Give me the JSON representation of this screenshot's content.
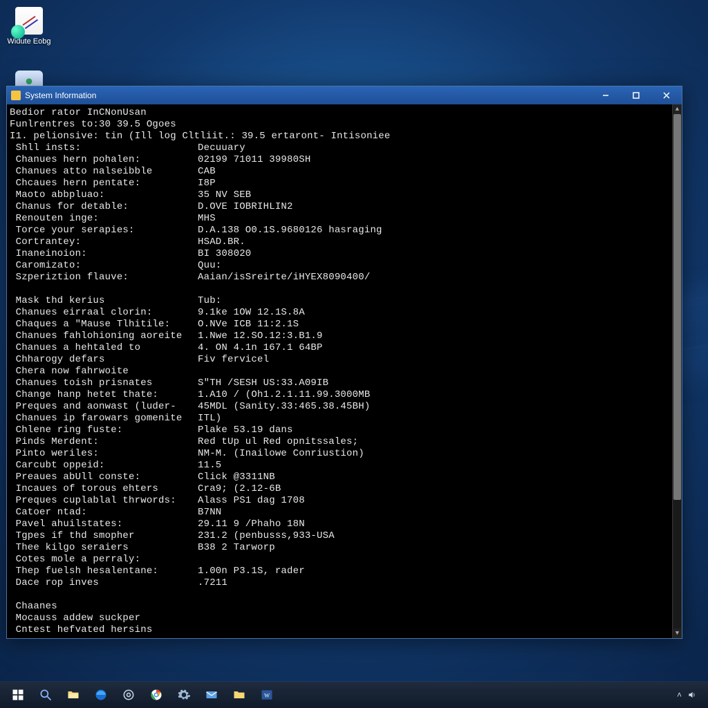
{
  "desktop": {
    "icon_editor_label": "Widute Eobg",
    "icon_user_label": ""
  },
  "window": {
    "title": "System Information"
  },
  "terminal": {
    "header": [
      "Bedior rator InCNonUsan",
      "Funlrentres to:30 39.5 Ogoes",
      "I1. pelionsive: tin (Ill log Cltliit.: 39.5 ertaront- Intisoniee"
    ],
    "rows": [
      {
        "label": "Shll insts:",
        "value": "Decuuary"
      },
      {
        "label": "Chanues hern pohalen:",
        "value": "02199 71011 39980SH"
      },
      {
        "label": "Chanues atto nalseibble",
        "value": "CAB"
      },
      {
        "label": "Chcaues hern pentate:",
        "value": "I8P"
      },
      {
        "label": "Maoto abbpluao:",
        "value": "35 NV SEB"
      },
      {
        "label": "Chanus for detable:",
        "value": "D.OVE IOBRIHLIN2"
      },
      {
        "label": "Renouten inge:",
        "value": "MHS"
      },
      {
        "label": "Torce your serapies:",
        "value": "D.A.138 O0.1S.9680126 hasraging"
      },
      {
        "label": "Cortrantey:",
        "value": "HSAD.BR."
      },
      {
        "label": "Inaneinoion:",
        "value": "BI 308020"
      },
      {
        "label": "Caromizato:",
        "value": "Quu:"
      },
      {
        "label": "Szperiztion flauve:",
        "value": "Aaian/isSreirte/iHYEX8090400/"
      },
      {
        "label": "",
        "value": ""
      },
      {
        "label": "Mask thd kerius",
        "value": "Tub:"
      },
      {
        "label": "Chanues eirraal clorin:",
        "value": "9.1ke 1OW 12.1S.8A"
      },
      {
        "label": "Chaques a \"Mause Tlhitile:",
        "value": "O.NVe ICB 11:2.1S"
      },
      {
        "label": "Chanues fahlohioning aoreite",
        "value": "1.Nwe 12.SO.12:3.B1.9"
      },
      {
        "label": "Chanues a hehtaled to",
        "value": "4. ON 4.1n 167.1 64BP"
      },
      {
        "label": "Chharogy defars",
        "value": "Fiv fervicel"
      },
      {
        "label": "Chera now fahrwoite",
        "value": ""
      },
      {
        "label": "Chanues toish prisnates",
        "value": "S\"TH /SESH US:33.A09IB"
      },
      {
        "label": "Change hanp hetet thate:",
        "value": "1.A10 / (Oh1.2.1.11.99.3000MB"
      },
      {
        "label": "Preques and aonwast (luder-",
        "value": "45MDL (Sanity.33:465.38.45BH)"
      },
      {
        "label": "Chanues ip farowars gomenite",
        "value": "ITL)"
      },
      {
        "label": "Chlene ring fuste:",
        "value": "Plake 53.19 dans"
      },
      {
        "label": "Pinds Merdent:",
        "value": "Red tUp ul Red opnitssales;"
      },
      {
        "label": "Pinto weriles:",
        "value": "NM-M. (Inailowe Conriustion)"
      },
      {
        "label": "Carcubt oppeid:",
        "value": "11.5"
      },
      {
        "label": "Preaues abUll conste:",
        "value": "Click @3311NB"
      },
      {
        "label": "Incaues of torous ehters",
        "value": "Cra9; (2.12-6B"
      },
      {
        "label": "Preques cuplablal thrwords:",
        "value": "Alass PS1 dag 1708"
      },
      {
        "label": "Catoer ntad:",
        "value": "B7NN"
      },
      {
        "label": "Pavel ahuilstates:",
        "value": "29.11 9 /Phaho 18N"
      },
      {
        "label": "Tgpes if thd smopher",
        "value": "231.2 (penbusss,933-USA"
      },
      {
        "label": "Thee kilgo seraiers",
        "value": "B38 2 Tarworp"
      },
      {
        "label": "Cotes mole a perraly:",
        "value": ""
      },
      {
        "label": "Thep fuelsh hesalentane:",
        "value": "1.00n P3.1S, rader"
      },
      {
        "label": "Dace rop inves",
        "value": ".7211"
      },
      {
        "label": "",
        "value": ""
      },
      {
        "label": "Chaanes",
        "value": ""
      },
      {
        "label": "Mocauss addew suckper",
        "value": ""
      },
      {
        "label": "Cntest hefvated hersins",
        "value": ""
      }
    ]
  },
  "taskbar": {
    "items": [
      "start",
      "search",
      "file-explorer",
      "edge-legacy",
      "chrome-outline",
      "chrome",
      "settings",
      "mail",
      "folder",
      "word"
    ]
  }
}
